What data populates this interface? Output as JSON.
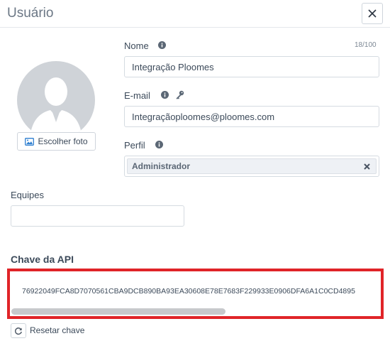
{
  "dialog": {
    "title": "Usuário",
    "close_icon": "close-icon"
  },
  "photo": {
    "button_label": "Escolher foto",
    "button_icon": "image-icon",
    "avatar_icon": "user-silhouette-icon"
  },
  "form": {
    "name": {
      "label": "Nome",
      "counter": "18/100",
      "value": "Integração Ploomes",
      "icon": "info-icon"
    },
    "email": {
      "label": "E-mail",
      "value": "Integraçãoploomes@ploomes.com",
      "icons": [
        "info-icon",
        "key-icon"
      ]
    },
    "profile": {
      "label": "Perfil",
      "selected": "Administrador",
      "remove_icon": "close-icon",
      "icon": "info-icon"
    },
    "teams": {
      "label": "Equipes",
      "value": ""
    }
  },
  "api": {
    "title": "Chave da API",
    "key": "76922049FCA8D7070561CBA9DCB890BA93EA30608E78E7683F229933E0906DFA6A1C0CD4895",
    "reset_label": "Resetar chave",
    "reset_icon": "refresh-icon"
  },
  "colors": {
    "highlight_border": "#e02428",
    "text": "#3c4a5a",
    "avatar_bg": "#cfd3d8"
  }
}
